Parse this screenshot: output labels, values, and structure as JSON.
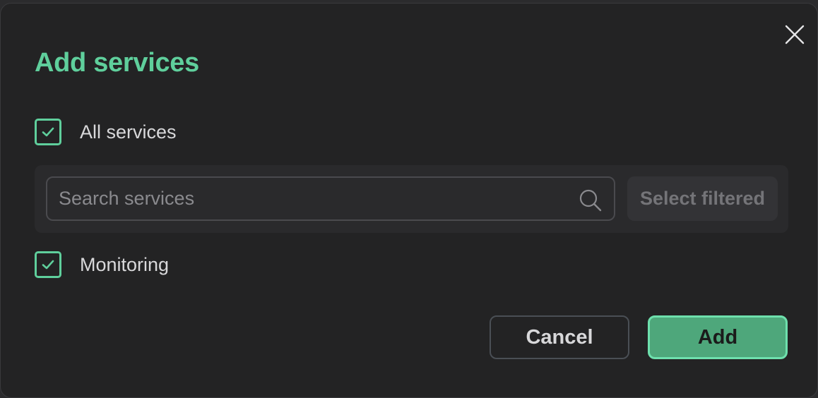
{
  "dialog": {
    "title": "Add services",
    "all_services_label": "All services",
    "all_services_checked": true,
    "search": {
      "placeholder": "Search services",
      "value": ""
    },
    "select_filtered_label": "Select filtered",
    "services": [
      {
        "label": "Monitoring",
        "checked": true
      }
    ],
    "cancel_label": "Cancel",
    "add_label": "Add"
  },
  "colors": {
    "accent": "#5fcf9c",
    "primary_button": "#4ea77b",
    "background": "#232324"
  },
  "icons": {
    "close": "close-icon",
    "search": "search-icon",
    "check": "check-icon"
  }
}
